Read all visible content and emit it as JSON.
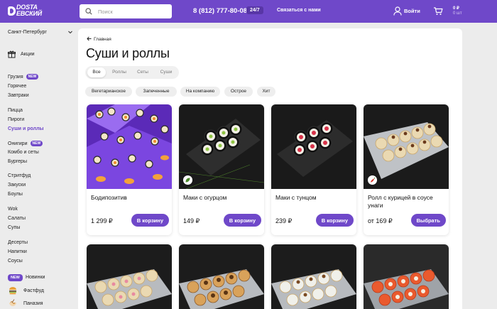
{
  "header": {
    "logo_line1": "DOSTA",
    "logo_line2": "EВСКИЙ",
    "search_placeholder": "Поиск",
    "phone": "8 (812) 777-80-08",
    "hours_badge": "24/7",
    "contact": "Связаться с нами",
    "login": "Войти",
    "cart_price": "0 ₽",
    "cart_count": "0 шт"
  },
  "sidebar": {
    "city": "Санкт-Петербург",
    "promo": "Акции",
    "new_tag": "NEW",
    "groups": [
      [
        "Грузия",
        "Горячее",
        "Завтраки"
      ],
      [
        "Пицца",
        "Пироги",
        "Суши и роллы"
      ],
      [
        "Онигири",
        "Комбо и сеты",
        "Бургеры"
      ],
      [
        "Стритфуд",
        "Закуски",
        "Боулы"
      ],
      [
        "Wok",
        "Салаты",
        "Супы"
      ],
      [
        "Десерты",
        "Напитки",
        "Соусы"
      ]
    ],
    "bottom": [
      "Новинки",
      "Фастфуд",
      "Паназия"
    ]
  },
  "main": {
    "back": "Главная",
    "title": "Суши и роллы",
    "tabs": [
      "Все",
      "Роллы",
      "Сеты",
      "Суши"
    ],
    "chips": [
      "Вегетарианское",
      "Запеченные",
      "На компанию",
      "Острое",
      "Хит"
    ]
  },
  "products": [
    {
      "name": "Бодипозитив",
      "price": "1 299 ₽",
      "button": "В корзину"
    },
    {
      "name": "Маки с огурцом",
      "price": "149 ₽",
      "button": "В корзину"
    },
    {
      "name": "Маки с тунцом",
      "price": "239 ₽",
      "button": "В корзину"
    },
    {
      "name": "Ролл с курицей в соусе унаги",
      "price": "от 169 ₽",
      "button": "Выбрать"
    }
  ],
  "colors": {
    "accent": "#6f48c9",
    "background": "#ececec"
  },
  "icons": [
    "search-icon",
    "user-icon",
    "cart-icon",
    "gift-icon",
    "arrow-left-icon",
    "chevron-down-icon",
    "leaf-icon",
    "chili-icon",
    "burger-icon",
    "noodles-icon"
  ]
}
